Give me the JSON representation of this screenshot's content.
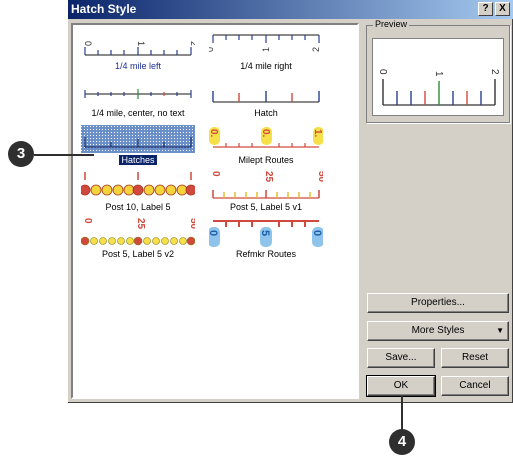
{
  "dialog": {
    "title": "Hatch Style",
    "help_glyph": "?",
    "close_glyph": "X"
  },
  "styles": [
    {
      "label": "1/4 mile left",
      "tick_labels": [
        "0",
        "1",
        "2"
      ]
    },
    {
      "label": "1/4 mile right",
      "tick_labels": [
        "0",
        "1",
        "2"
      ]
    },
    {
      "label": "1/4 mile, center, no text"
    },
    {
      "label": "Hatch"
    },
    {
      "label": "Hatches",
      "selected": true
    },
    {
      "label": "Milept Routes",
      "tick_labels": [
        "0.",
        "0.",
        "1."
      ]
    },
    {
      "label": "Post 10, Label 5"
    },
    {
      "label": "Post 5, Label 5 v1",
      "tick_labels": [
        "0",
        "25",
        "50"
      ]
    },
    {
      "label": "Post 5, Label 5 v2",
      "tick_labels": [
        "0",
        "25",
        "50"
      ]
    },
    {
      "label": "Refmkr Routes",
      "tick_labels": [
        "0",
        "5",
        "0"
      ]
    }
  ],
  "preview": {
    "group_title": "Preview",
    "tick_labels": [
      "0",
      "1",
      "2"
    ]
  },
  "buttons": {
    "properties": "Properties...",
    "more_styles": "More Styles",
    "save": "Save...",
    "reset": "Reset",
    "ok": "OK",
    "cancel": "Cancel"
  },
  "callouts": [
    "3",
    "4"
  ],
  "colors": {
    "titlebar_start": "#0a246a",
    "titlebar_end": "#a6caf0",
    "selection": "#0a246a",
    "milepost_yellow": "#f5e04a",
    "marker_red": "#e3242b",
    "refmkr_blue": "#2f74c0"
  }
}
